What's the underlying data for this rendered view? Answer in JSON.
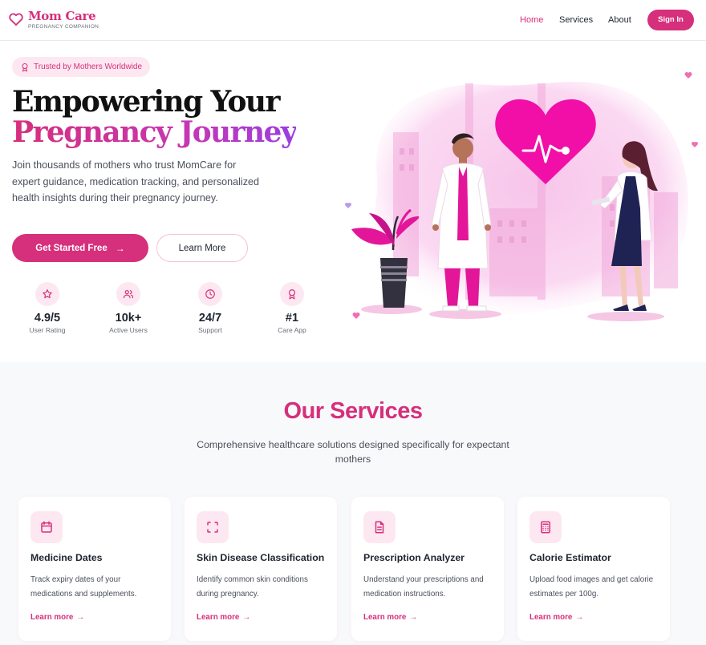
{
  "brand": {
    "name": "Mom Care",
    "tagline": "PREGNANCY COMPANION",
    "accent": "#d62f7c"
  },
  "nav": {
    "links": [
      {
        "label": "Home",
        "active": true
      },
      {
        "label": "Services",
        "active": false
      },
      {
        "label": "About",
        "active": false
      }
    ],
    "signin_label": "Sign In"
  },
  "hero": {
    "badge": "Trusted by Mothers Worldwide",
    "title_line1": "Empowering Your",
    "title_line2": "Pregnancy Journey",
    "lead": "Join thousands of mothers who trust MomCare for expert guidance, medication tracking, and personalized health insights during their pregnancy journey.",
    "primary_button": "Get Started Free",
    "secondary_button": "Learn More",
    "stats": [
      {
        "icon": "star-icon",
        "value": "4.9/5",
        "label": "User Rating"
      },
      {
        "icon": "users-icon",
        "value": "10k+",
        "label": "Active Users"
      },
      {
        "icon": "clock-icon",
        "value": "24/7",
        "label": "Support"
      },
      {
        "icon": "award-icon",
        "value": "#1",
        "label": "Care App"
      }
    ]
  },
  "services": {
    "title": "Our Services",
    "subtitle": "Comprehensive healthcare solutions designed specifically for expectant mothers",
    "cards": [
      {
        "icon": "calendar-icon",
        "title": "Medicine Dates",
        "description": "Track expiry dates of your medications and supplements.",
        "link": "Learn more"
      },
      {
        "icon": "scan-icon",
        "title": "Skin Disease Classification",
        "description": "Identify common skin conditions during pregnancy.",
        "link": "Learn more"
      },
      {
        "icon": "document-icon",
        "title": "Prescription Analyzer",
        "description": "Understand your prescriptions and medication instructions.",
        "link": "Learn more"
      },
      {
        "icon": "calculator-icon",
        "title": "Calorie Estimator",
        "description": "Upload food images and get calorie estimates per 100g.",
        "link": "Learn more"
      }
    ]
  }
}
